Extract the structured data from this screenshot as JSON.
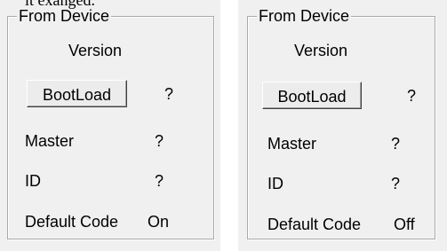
{
  "caption": "it exanged.",
  "panels": [
    {
      "group_title": "From Device",
      "version_label": "Version",
      "bootload_button": "BootLoad",
      "version_value": "?",
      "master_label": "Master",
      "master_value": "?",
      "id_label": "ID",
      "id_value": "?",
      "default_code_label": "Default Code",
      "default_code_value": "On"
    },
    {
      "group_title": "From Device",
      "version_label": "Version",
      "bootload_button": "BootLoad",
      "version_value": "?",
      "master_label": "Master",
      "master_value": "?",
      "id_label": "ID",
      "id_value": "?",
      "default_code_label": "Default Code",
      "default_code_value": "Off"
    }
  ]
}
